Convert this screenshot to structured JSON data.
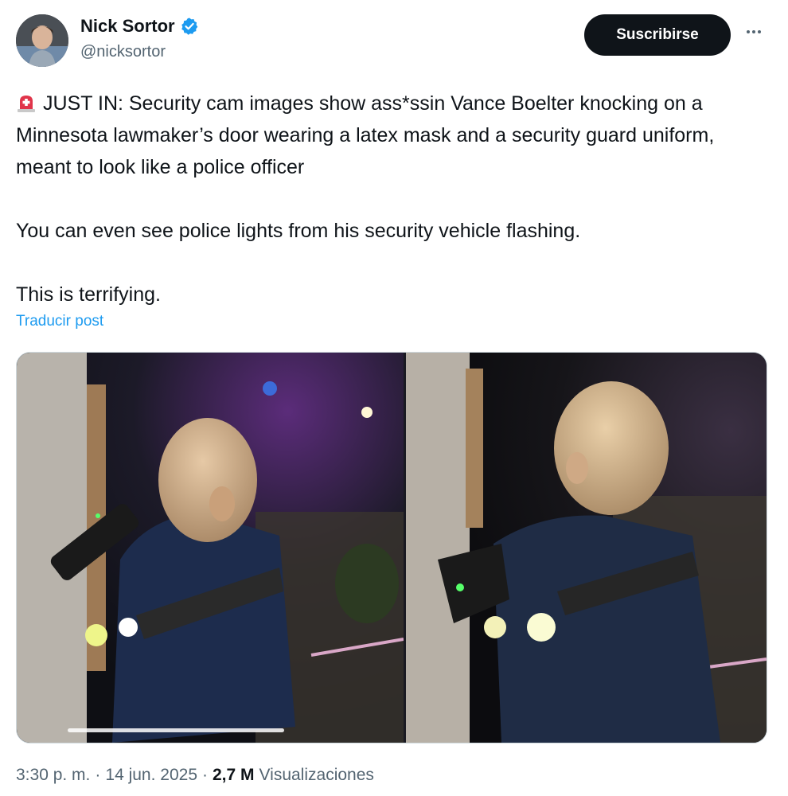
{
  "author": {
    "display_name": "Nick Sortor",
    "handle": "@nicksortor",
    "verified_icon": "verified-badge-icon",
    "avatar_icon": "profile-avatar"
  },
  "actions": {
    "subscribe_label": "Suscribirse",
    "more_icon": "more-options-icon"
  },
  "post": {
    "alarm_icon": "rotating-light-emoji",
    "paragraphs": [
      "JUST IN: Security cam images show ass*ssin Vance Boelter knocking on a Minnesota lawmaker’s door wearing a latex mask and a security guard uniform, meant to look like a police officer",
      "You can even see police lights from his security vehicle flashing.",
      "This is terrifying."
    ],
    "translate_label": "Traducir post"
  },
  "media": {
    "count": 2
  },
  "meta": {
    "time": "3:30 p. m.",
    "separator": "·",
    "date": "14 jun. 2025",
    "views_count": "2,7 M",
    "views_label": "Visualizaciones"
  },
  "colors": {
    "accent": "#1d9bf0",
    "text": "#0f1419",
    "secondary": "#536471",
    "button_bg": "#0f1419"
  }
}
